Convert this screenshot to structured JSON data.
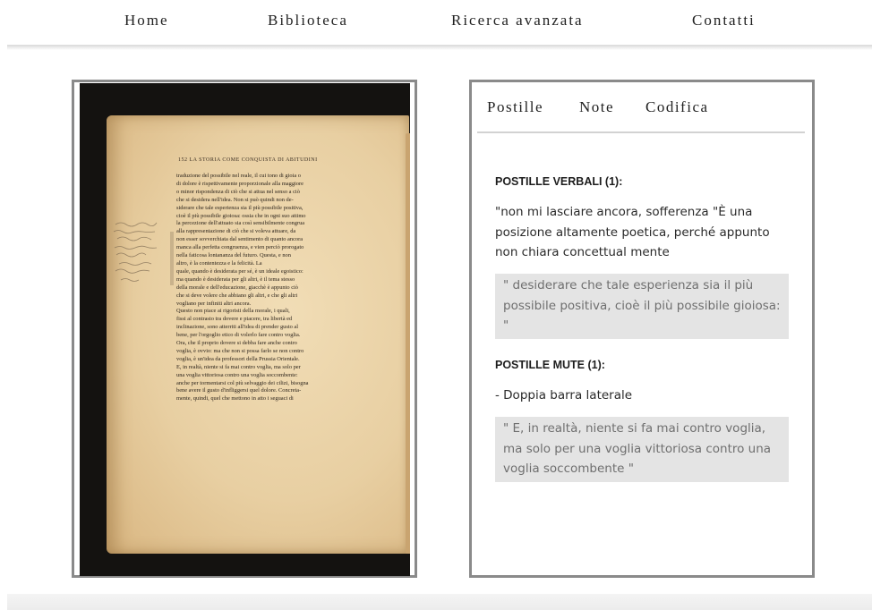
{
  "nav": {
    "items": [
      "Home",
      "Biblioteca",
      "Ricerca avanzata",
      "Contatti"
    ]
  },
  "scan": {
    "header": "152   LA STORIA COME CONQUISTA DI ABITUDINI",
    "text": "traduzione del possibile nel reale, il cui tono di gioia o\ndi dolore è rispettivamente proporzionale alla maggiore\no minor rispondenza di ciò che si attua nel senso a ciò\nche si desidera nell'idea. Non si può quindi non de-\nsiderare che tale esperienza sia il più possibile positiva,\ncioè il più possibile gioiosa: ossia che in ogni suo attimo\nla percezione dell'attuato sia così sensibilmente congrua\nalla rappresentazione di ciò che si voleva attuare, da\nnon esser sovverchiata dal sentimento di quanto ancora\nmanca alla perfetta congruenza, e vien perciò prorogato\nnella faticosa lontananza del futuro. Questa, e non\naltro, è la contentezza e la felicità. La\nquale, quando è desiderata per sé, è un ideale egoistico:\nma quando è desiderata per gli altri, è il tema stesso\ndella morale e dell'educazione, giacchè è appunto ciò\nche si deve volere che abbiano gli altri, e che gli altri\nvogliano per infiniti altri ancora.\n    Questo non piace ai rigoristi della morale, i quali,\nfissi al contrasto tra dovere e piacere, tra libertà ed\ninclinazione, sono atterriti all'idea di prender gusto al\nbene, per l'orgoglio etico di volerlo fare contro voglia.\nOra, che il proprio dovere si debba fare anche contro\nvoglia, è ovvio: ma che non si possa farlo se non contro\nvoglia, è un'idea da professori della Prussia Orientale.\nE, in realtà, niente si fa mai contro voglia, ma solo per\nuna voglia vittoriosa contro una voglia soccombente:\nanche per tormentarsi col più selvaggio dei cilizi, bisogna\nbene avere il gusto d'infliggersi quel dolore. Concreta-\nmente, quindi, quel che mettono in atto i seguaci di"
  },
  "panel": {
    "tabs": [
      "Postille",
      "Note",
      "Codifica"
    ],
    "verbali_title": "POSTILLE VERBALI (1):",
    "verbali_text": "\"non mi lasciare ancora, sofferenza \"È una posizione altamente poetica, perché appunto non chiara concettual mente",
    "verbali_quote": "\" desiderare che tale esperienza sia il più possibile positiva, cioè il più possibile gioiosa: \"",
    "mute_title": "POSTILLE MUTE (1):",
    "mute_text": "- Doppia barra laterale",
    "mute_quote": "\" E, in realtà, niente si fa mai contro voglia, ma solo per una voglia vittoriosa contro una voglia soccombente \""
  },
  "colors": {
    "frame": "#8a8a8a",
    "quote_bg": "#e4e4e4",
    "page_paper": "#ecd4a8",
    "scan_background": "#141210"
  }
}
